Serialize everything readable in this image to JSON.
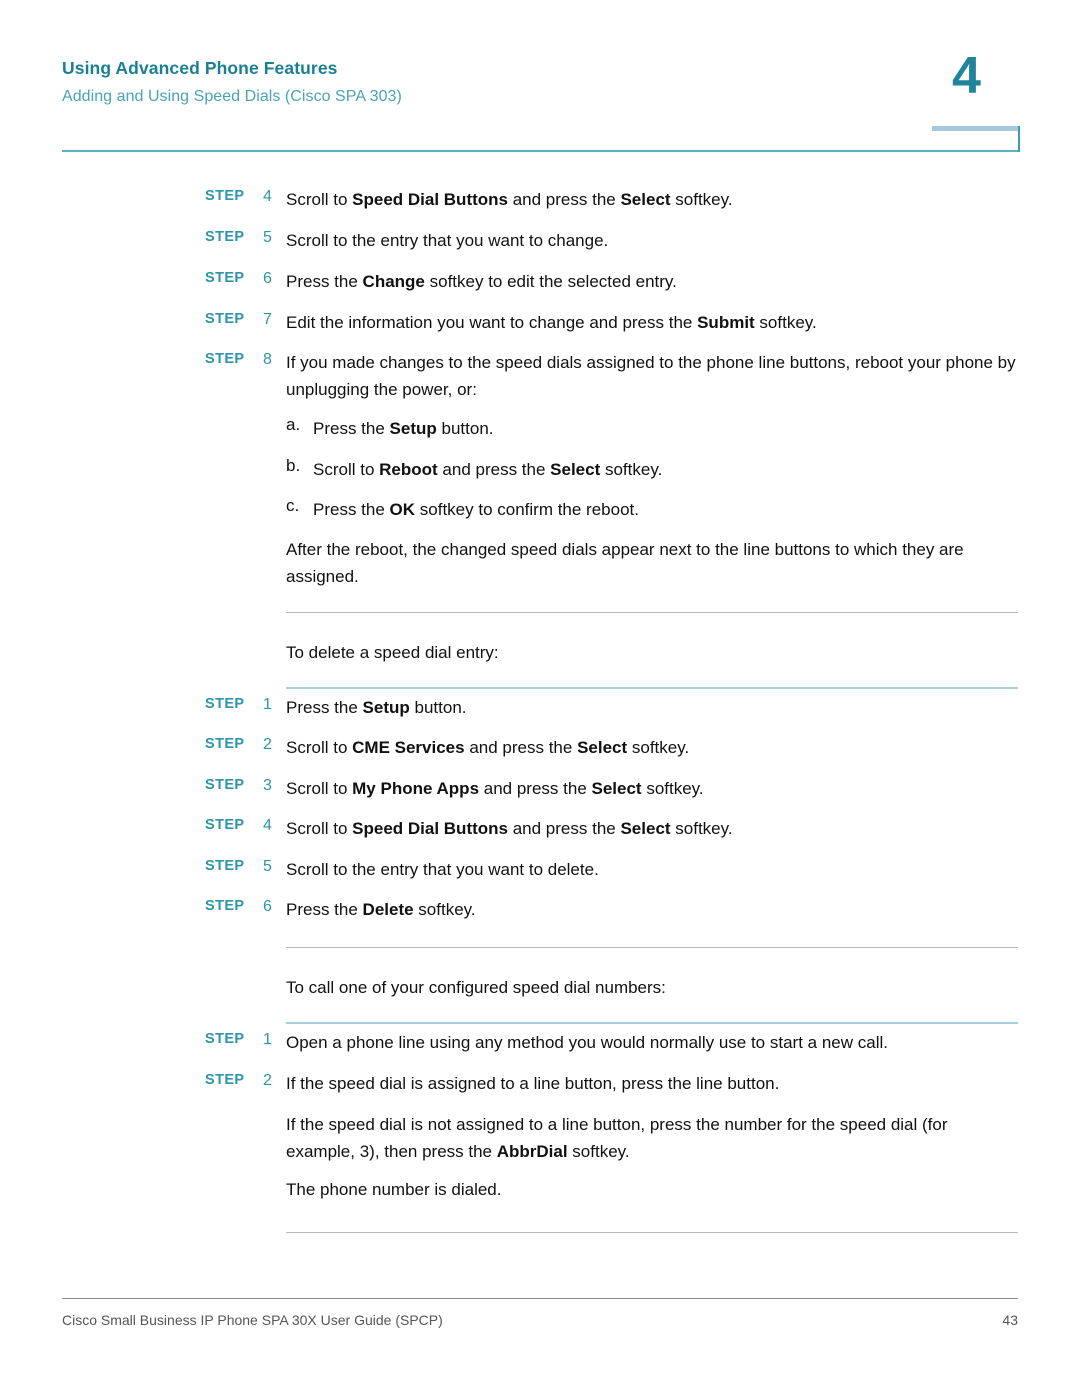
{
  "header": {
    "title": "Using Advanced Phone Features",
    "subtitle": "Adding and Using Speed Dials (Cisco SPA 303)",
    "chapter_number": "4",
    "accent_color": "#1a7f93",
    "subtitle_color": "#4aa3b5",
    "rule_color": "#5bb3c2",
    "tab_top_color": "#a8c8dd"
  },
  "step_label": "STEP",
  "sections": [
    {
      "id": "change-speed-dial-continued",
      "steps": [
        {
          "number": "4",
          "parts": [
            {
              "t": "Scroll to ",
              "b": false
            },
            {
              "t": "Speed Dial Buttons",
              "b": true
            },
            {
              "t": " and press the ",
              "b": false
            },
            {
              "t": "Select",
              "b": true
            },
            {
              "t": " softkey.",
              "b": false
            }
          ]
        },
        {
          "number": "5",
          "parts": [
            {
              "t": "Scroll to the entry that you want to change.",
              "b": false
            }
          ]
        },
        {
          "number": "6",
          "parts": [
            {
              "t": "Press the ",
              "b": false
            },
            {
              "t": "Change",
              "b": true
            },
            {
              "t": " softkey to edit the selected entry.",
              "b": false
            }
          ]
        },
        {
          "number": "7",
          "parts": [
            {
              "t": "Edit the information you want to change and press the ",
              "b": false
            },
            {
              "t": "Submit",
              "b": true
            },
            {
              "t": " softkey.",
              "b": false
            }
          ]
        },
        {
          "number": "8",
          "parts": [
            {
              "t": "If you made changes to the speed dials assigned to the phone line buttons, reboot your phone by unplugging the power, or:",
              "b": false
            }
          ]
        }
      ],
      "substeps": [
        {
          "marker": "a.",
          "parts": [
            {
              "t": "Press the ",
              "b": false
            },
            {
              "t": "Setup",
              "b": true
            },
            {
              "t": " button.",
              "b": false
            }
          ]
        },
        {
          "marker": "b.",
          "parts": [
            {
              "t": "Scroll to ",
              "b": false
            },
            {
              "t": "Reboot",
              "b": true
            },
            {
              "t": " and press the ",
              "b": false
            },
            {
              "t": "Select",
              "b": true
            },
            {
              "t": " softkey.",
              "b": false
            }
          ]
        },
        {
          "marker": "c.",
          "parts": [
            {
              "t": "Press the ",
              "b": false
            },
            {
              "t": "OK",
              "b": true
            },
            {
              "t": " softkey to confirm the reboot.",
              "b": false
            }
          ]
        }
      ],
      "closing_paragraph": "After the reboot, the changed speed dials appear next to the line buttons to which they are assigned."
    },
    {
      "id": "delete-speed-dial",
      "intro": "To delete a speed dial entry:",
      "steps": [
        {
          "number": "1",
          "parts": [
            {
              "t": "Press the ",
              "b": false
            },
            {
              "t": "Setup",
              "b": true
            },
            {
              "t": " button.",
              "b": false
            }
          ]
        },
        {
          "number": "2",
          "parts": [
            {
              "t": "Scroll to ",
              "b": false
            },
            {
              "t": "CME Services",
              "b": true
            },
            {
              "t": " and press the ",
              "b": false
            },
            {
              "t": "Select",
              "b": true
            },
            {
              "t": " softkey.",
              "b": false
            }
          ]
        },
        {
          "number": "3",
          "parts": [
            {
              "t": "Scroll to ",
              "b": false
            },
            {
              "t": "My Phone Apps",
              "b": true
            },
            {
              "t": " and press the ",
              "b": false
            },
            {
              "t": "Select",
              "b": true
            },
            {
              "t": " softkey.",
              "b": false
            }
          ]
        },
        {
          "number": "4",
          "parts": [
            {
              "t": "Scroll to ",
              "b": false
            },
            {
              "t": "Speed Dial Buttons",
              "b": true
            },
            {
              "t": " and press the ",
              "b": false
            },
            {
              "t": "Select",
              "b": true
            },
            {
              "t": " softkey.",
              "b": false
            }
          ]
        },
        {
          "number": "5",
          "parts": [
            {
              "t": "Scroll to the entry that you want to delete.",
              "b": false
            }
          ]
        },
        {
          "number": "6",
          "parts": [
            {
              "t": "Press the ",
              "b": false
            },
            {
              "t": "Delete",
              "b": true
            },
            {
              "t": " softkey.",
              "b": false
            }
          ]
        }
      ]
    },
    {
      "id": "call-speed-dial",
      "intro": "To call one of your configured speed dial numbers:",
      "steps": [
        {
          "number": "1",
          "parts": [
            {
              "t": "Open a phone line using any method you would normally use to start a new call.",
              "b": false
            }
          ]
        },
        {
          "number": "2",
          "parts": [
            {
              "t": "If the speed dial is assigned to a line button, press the line button.",
              "b": false
            }
          ]
        }
      ],
      "trailing_paragraphs": [
        [
          {
            "t": "If the speed dial is not assigned to a line button, press the number for the speed dial (for example, 3), then press the ",
            "b": false
          },
          {
            "t": "AbbrDial",
            "b": true
          },
          {
            "t": " softkey.",
            "b": false
          }
        ],
        [
          {
            "t": "The phone number is dialed.",
            "b": false
          }
        ]
      ]
    }
  ],
  "footer": {
    "text": "Cisco Small Business IP Phone SPA 30X User Guide (SPCP)",
    "page_number": "43"
  }
}
